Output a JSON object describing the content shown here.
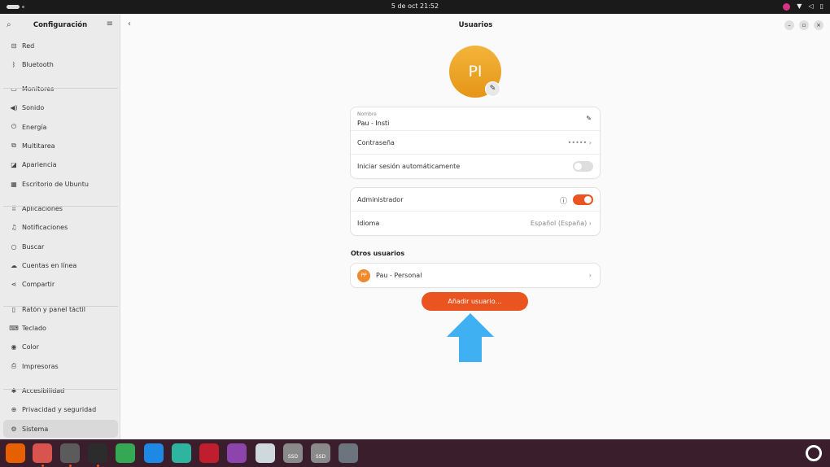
{
  "topbar": {
    "clock": "5 de oct  21:52"
  },
  "sidebar": {
    "title": "Configuración",
    "items": [
      {
        "label": "Red",
        "icon": "network-icon",
        "glyph": "⊟"
      },
      {
        "label": "Bluetooth",
        "icon": "bluetooth-icon",
        "glyph": "ᛒ"
      },
      {
        "label": "Monitores",
        "icon": "monitor-icon",
        "glyph": "▭"
      },
      {
        "label": "Sonido",
        "icon": "speaker-icon",
        "glyph": "◀)"
      },
      {
        "label": "Energía",
        "icon": "power-icon",
        "glyph": "⏻"
      },
      {
        "label": "Multitarea",
        "icon": "multitask-icon",
        "glyph": "⧉"
      },
      {
        "label": "Apariencia",
        "icon": "appearance-icon",
        "glyph": "◪"
      },
      {
        "label": "Escritorio de Ubuntu",
        "icon": "desktop-icon",
        "glyph": "▦"
      },
      {
        "label": "Aplicaciones",
        "icon": "apps-icon",
        "glyph": "⠿"
      },
      {
        "label": "Notificaciones",
        "icon": "bell-icon",
        "glyph": "♫"
      },
      {
        "label": "Buscar",
        "icon": "search-icon",
        "glyph": "○"
      },
      {
        "label": "Cuentas en línea",
        "icon": "cloud-icon",
        "glyph": "☁"
      },
      {
        "label": "Compartir",
        "icon": "share-icon",
        "glyph": "⋖"
      },
      {
        "label": "Ratón y panel táctil",
        "icon": "mouse-icon",
        "glyph": "▯"
      },
      {
        "label": "Teclado",
        "icon": "keyboard-icon",
        "glyph": "⌨"
      },
      {
        "label": "Color",
        "icon": "color-icon",
        "glyph": "◉"
      },
      {
        "label": "Impresoras",
        "icon": "printer-icon",
        "glyph": "⎙"
      },
      {
        "label": "Accesibilidad",
        "icon": "accessibility-icon",
        "glyph": "✱"
      },
      {
        "label": "Privacidad y seguridad",
        "icon": "lock-icon",
        "glyph": "⊕"
      },
      {
        "label": "Sistema",
        "icon": "gear-icon",
        "glyph": "⚙"
      }
    ]
  },
  "main": {
    "title": "Usuarios",
    "avatar_initials": "PI",
    "account": {
      "name_label": "Nombre",
      "name_value": "Pau - Insti",
      "password_label": "Contraseña",
      "password_value": "•••••",
      "autologin_label": "Iniciar sesión automáticamente",
      "autologin_on": false
    },
    "admin": {
      "admin_label": "Administrador",
      "admin_on": true,
      "language_label": "Idioma",
      "language_value": "Español (España)"
    },
    "others_title": "Otros usuarios",
    "others": [
      {
        "initials": "PP",
        "name": "Pau - Personal"
      }
    ],
    "add_user_label": "Añadir usuario…"
  },
  "colors": {
    "accent": "#e95420",
    "arrow": "#3fb0f2",
    "avatar": "#e99a1f"
  },
  "dock": {
    "items": [
      {
        "name": "firefox-icon",
        "color": "#e66000"
      },
      {
        "name": "files-icon",
        "color": "#d9534f"
      },
      {
        "name": "settings-icon",
        "color": "#5b5b5b"
      },
      {
        "name": "terminal-icon",
        "color": "#2c2c2c"
      },
      {
        "name": "chrome-icon",
        "color": "#34a853"
      },
      {
        "name": "vscode-icon",
        "color": "#1e88e5"
      },
      {
        "name": "codeblocks-icon",
        "color": "#2eb5a0"
      },
      {
        "name": "filezilla-icon",
        "color": "#bf1e2e"
      },
      {
        "name": "firefox-dev-icon",
        "color": "#8e44ad"
      },
      {
        "name": "image-viewer-icon",
        "color": "#cfd8dc"
      },
      {
        "name": "drive-icon",
        "color": "#8a8a8a"
      },
      {
        "name": "drive-icon",
        "color": "#8a8a8a"
      },
      {
        "name": "trash-icon",
        "color": "#6c757d"
      }
    ],
    "drive_label": "SSD"
  }
}
